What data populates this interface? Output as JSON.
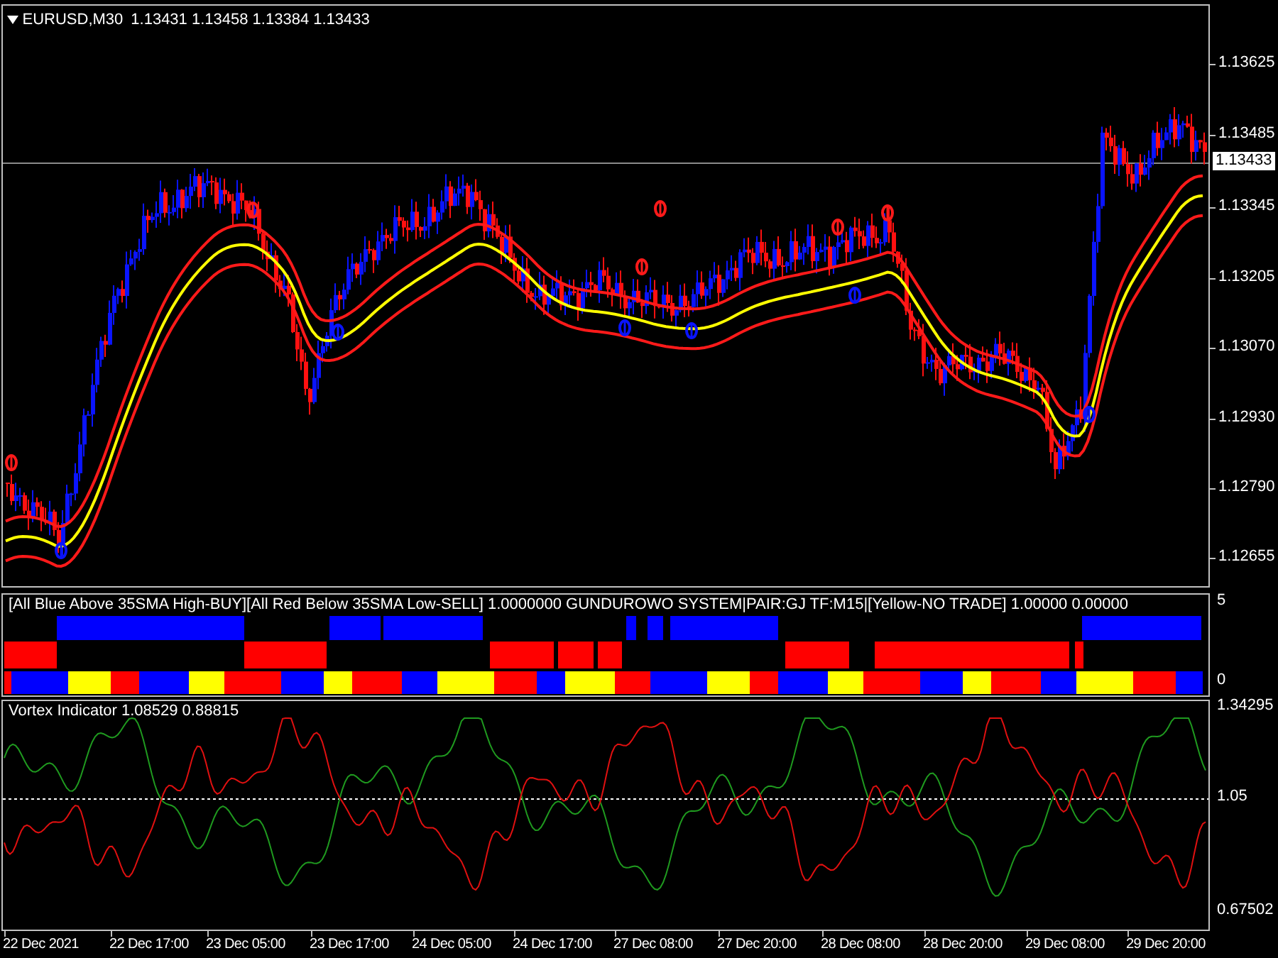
{
  "chart": {
    "symbol": "EURUSD,M30",
    "ohlc": "1.13431 1.13458 1.13384 1.13433",
    "price_labels": [
      "1.13625",
      "1.13485",
      "1.13345",
      "1.13205",
      "1.13070",
      "1.12930",
      "1.12790",
      "1.12655"
    ],
    "current_price": "1.13433"
  },
  "histogram": {
    "title": "[All Blue Above 35SMA High-BUY][All Red Below 35SMA Low-SELL] 1.0000000  GUNDUROWO SYSTEM|PAIR:GJ TF:M15|[Yellow-NO TRADE] 1.00000 0.00000",
    "scale_labels": [
      "5",
      "0"
    ]
  },
  "vortex": {
    "title": "Vortex Indicator 1.08529 0.88815",
    "scale_labels": [
      "1.34295",
      "1.05",
      "0.67502"
    ]
  },
  "time_axis": {
    "labels": [
      "22 Dec 2021",
      "22 Dec 17:00",
      "23 Dec 05:00",
      "23 Dec 17:00",
      "24 Dec 05:00",
      "24 Dec 17:00",
      "27 Dec 08:00",
      "27 Dec 20:00",
      "28 Dec 08:00",
      "28 Dec 20:00",
      "29 Dec 08:00",
      "29 Dec 20:00"
    ]
  }
}
